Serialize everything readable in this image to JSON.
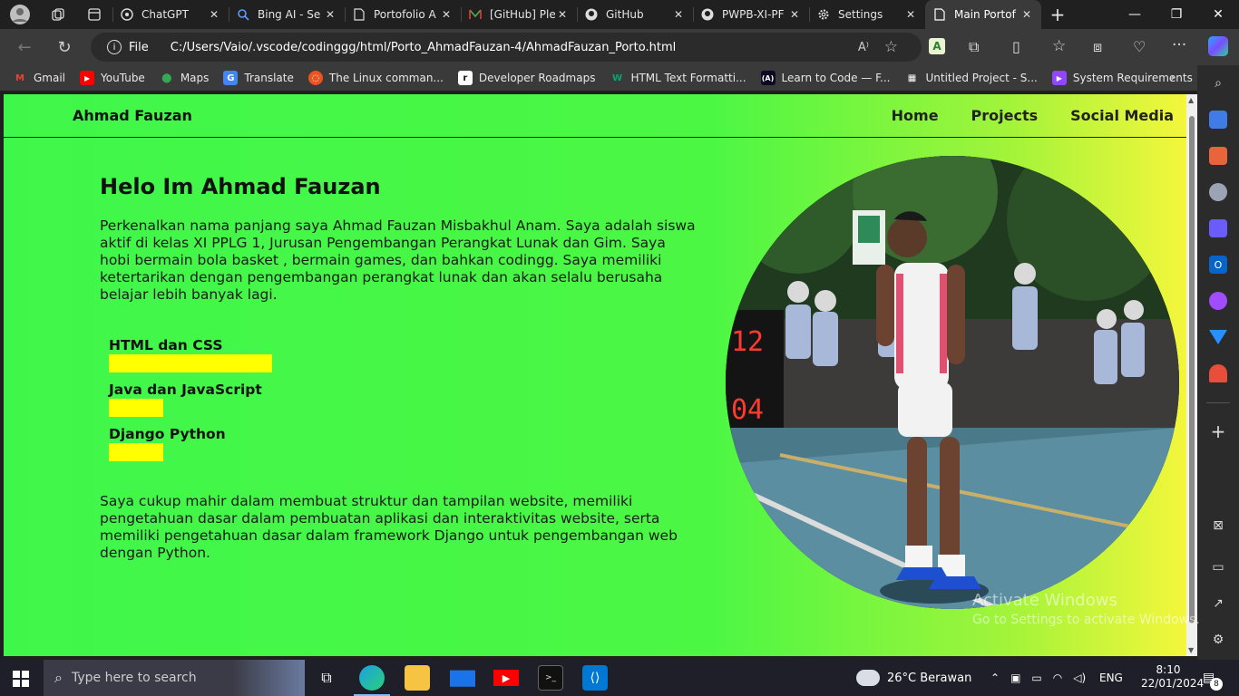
{
  "browser": {
    "tabs": [
      {
        "title": "ChatGPT",
        "icon": "chatgpt-icon"
      },
      {
        "title": "Bing AI - Se",
        "icon": "search-icon"
      },
      {
        "title": "Portofolio A",
        "icon": "page-icon"
      },
      {
        "title": "[GitHub] Ple",
        "icon": "mail-icon"
      },
      {
        "title": "GitHub",
        "icon": "github-icon"
      },
      {
        "title": "PWPB-XI-PF",
        "icon": "github-icon"
      },
      {
        "title": "Settings",
        "icon": "gear-icon"
      },
      {
        "title": "Main Portof",
        "icon": "page-icon",
        "active": true
      }
    ],
    "address": {
      "scheme_label": "File",
      "url": "C:/Users/Vaio/.vscode/codinggg/html/Porto_AhmadFauzan-4/AhmadFauzan_Porto.html"
    },
    "bookmarks": [
      {
        "label": "Gmail",
        "icon": "gmail-icon",
        "color": "#ea4335"
      },
      {
        "label": "YouTube",
        "icon": "youtube-icon",
        "color": "#ff0000"
      },
      {
        "label": "Maps",
        "icon": "maps-icon",
        "color": "#34a853"
      },
      {
        "label": "Translate",
        "icon": "translate-icon",
        "color": "#4285f4"
      },
      {
        "label": "The Linux comman...",
        "icon": "ubuntu-icon",
        "color": "#e95420"
      },
      {
        "label": "Developer Roadmaps",
        "icon": "roadmap-icon",
        "color": "#ffffff"
      },
      {
        "label": "HTML Text Formatti...",
        "icon": "w3schools-icon",
        "color": "#04aa6d"
      },
      {
        "label": "Learn to Code — F...",
        "icon": "freecodecamp-icon",
        "color": "#0a0a23"
      },
      {
        "label": "Untitled Project - S...",
        "icon": "grid-icon",
        "color": "#ffffff"
      },
      {
        "label": "System Requirements",
        "icon": "twitch-icon",
        "color": "#9146ff"
      }
    ]
  },
  "site": {
    "brand": "Ahmad Fauzan",
    "nav": [
      "Home",
      "Projects",
      "Social Media"
    ],
    "heading": "Helo Im Ahmad Fauzan",
    "intro": "Perkenalkan nama panjang saya Ahmad Fauzan Misbakhul Anam. Saya adalah siswa aktif di kelas XI PPLG 1, Jurusan Pengembangan Perangkat Lunak dan Gim. Saya hobi bermain bola basket , bermain games, dan bahkan codingg. Saya memiliki ketertarikan dengan pengembangan perangkat lunak dan akan selalu berusaha belajar lebih banyak lagi.",
    "skills": [
      {
        "name": "HTML dan CSS",
        "level": 0.75
      },
      {
        "name": "Java dan JavaScript",
        "level": 0.25
      },
      {
        "name": "Django Python",
        "level": 0.25
      }
    ],
    "summary": "Saya cukup mahir dalam membuat struktur dan tampilan website, memiliki pengetahuan dasar dalam pembuatan aplikasi dan interaktivitas website, serta memiliki pengetahuan dasar dalam framework Django untuk pengembangan web dengan Python."
  },
  "watermark": {
    "title": "Activate Windows",
    "subtitle": "Go to Settings to activate Windows."
  },
  "taskbar": {
    "search_placeholder": "Type here to search",
    "weather": "26°C  Berawan",
    "language": "ENG",
    "time": "8:10",
    "date": "22/01/2024",
    "notifications": "8"
  }
}
